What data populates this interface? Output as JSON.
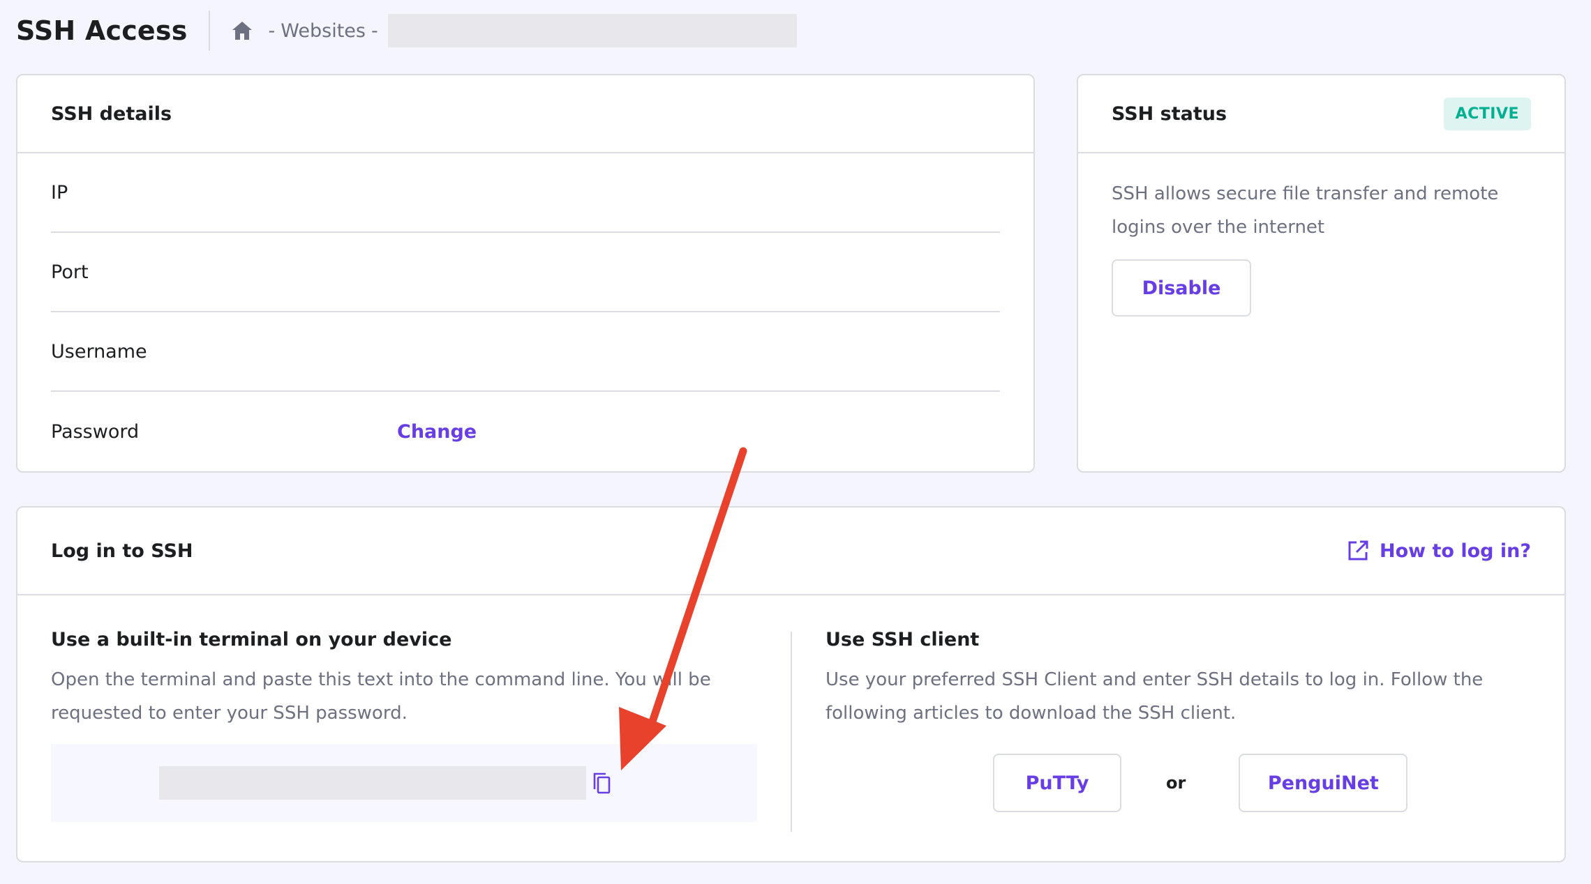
{
  "header": {
    "title": "SSH Access",
    "breadcrumb": {
      "home_icon": "home-icon",
      "separator": "-",
      "item": "Websites"
    }
  },
  "ssh_details": {
    "title": "SSH details",
    "rows": [
      {
        "label": "IP",
        "value": ""
      },
      {
        "label": "Port",
        "value": ""
      },
      {
        "label": "Username",
        "value": ""
      },
      {
        "label": "Password",
        "action": "Change"
      }
    ]
  },
  "ssh_status": {
    "title": "SSH status",
    "badge": "ACTIVE",
    "description": "SSH allows secure file transfer and remote logins over the internet",
    "disable_label": "Disable"
  },
  "login": {
    "title": "Log in to SSH",
    "how_to_label": "How to log in?",
    "terminal": {
      "title": "Use a built-in terminal on your device",
      "description": "Open the terminal and paste this text into the command line. You will be requested to enter your SSH password."
    },
    "client": {
      "title": "Use SSH client",
      "description": "Use your preferred SSH Client and enter SSH details to log in. Follow the following articles to download the SSH client.",
      "putty_label": "PuTTy",
      "or_label": "or",
      "penguinet_label": "PenguiNet"
    }
  },
  "colors": {
    "accent": "#673de6",
    "badge_bg": "#def4f0",
    "badge_text": "#00b090",
    "annotation_arrow": "#e8412c"
  }
}
